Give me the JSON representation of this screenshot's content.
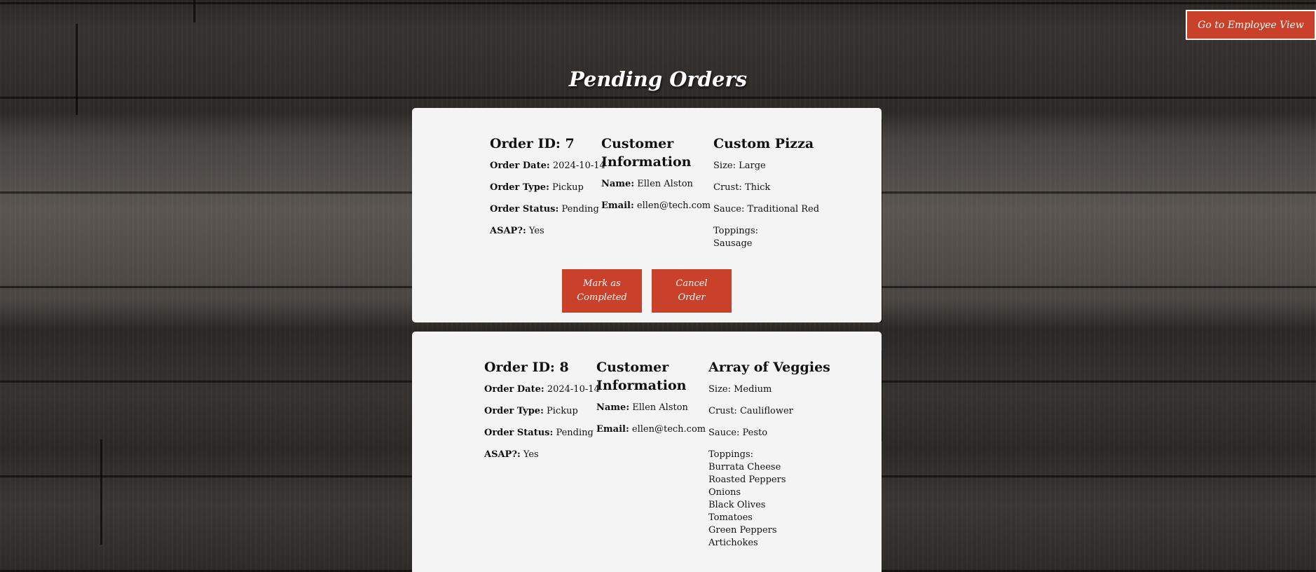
{
  "header": {
    "employee_view_button": "Go to Employee View",
    "title": "Pending Orders"
  },
  "labels": {
    "order_id_prefix": "Order ID: ",
    "order_date": "Order Date:",
    "order_type": "Order Type:",
    "order_status": "Order Status:",
    "asap": "ASAP?:",
    "customer_info": "Customer Information",
    "name": "Name:",
    "email": "Email:",
    "size": "Size: ",
    "crust": "Crust: ",
    "sauce": "Sauce: ",
    "toppings": "Toppings:"
  },
  "orders": [
    {
      "order_id_title": "Order ID: 7",
      "order_date": "2024-10-14",
      "order_type": "Pickup",
      "order_status": "Pending",
      "asap": "Yes",
      "customer_name": "Ellen Alston",
      "customer_email": "ellen@tech.com",
      "pizza_name": "Custom Pizza",
      "size": "Size: Large",
      "crust": "Crust: Thick",
      "sauce": "Sauce: Traditional Red",
      "toppings": [
        "Sausage"
      ],
      "complete_button": "Mark as Completed",
      "cancel_button": "Cancel Order"
    },
    {
      "order_id_title": "Order ID: 8",
      "order_date": "2024-10-14",
      "order_type": "Pickup",
      "order_status": "Pending",
      "asap": "Yes",
      "customer_name": "Ellen Alston",
      "customer_email": "ellen@tech.com",
      "pizza_name": "Array of Veggies",
      "size": "Size: Medium",
      "crust": "Crust: Cauliflower",
      "sauce": "Sauce: Pesto",
      "toppings": [
        "Burrata Cheese",
        "Roasted Peppers",
        "Onions",
        "Black Olives",
        "Tomatoes",
        "Green Peppers",
        "Artichokes"
      ]
    }
  ],
  "colors": {
    "accent": "#c9412a",
    "card_background": "#f4f4f4"
  }
}
